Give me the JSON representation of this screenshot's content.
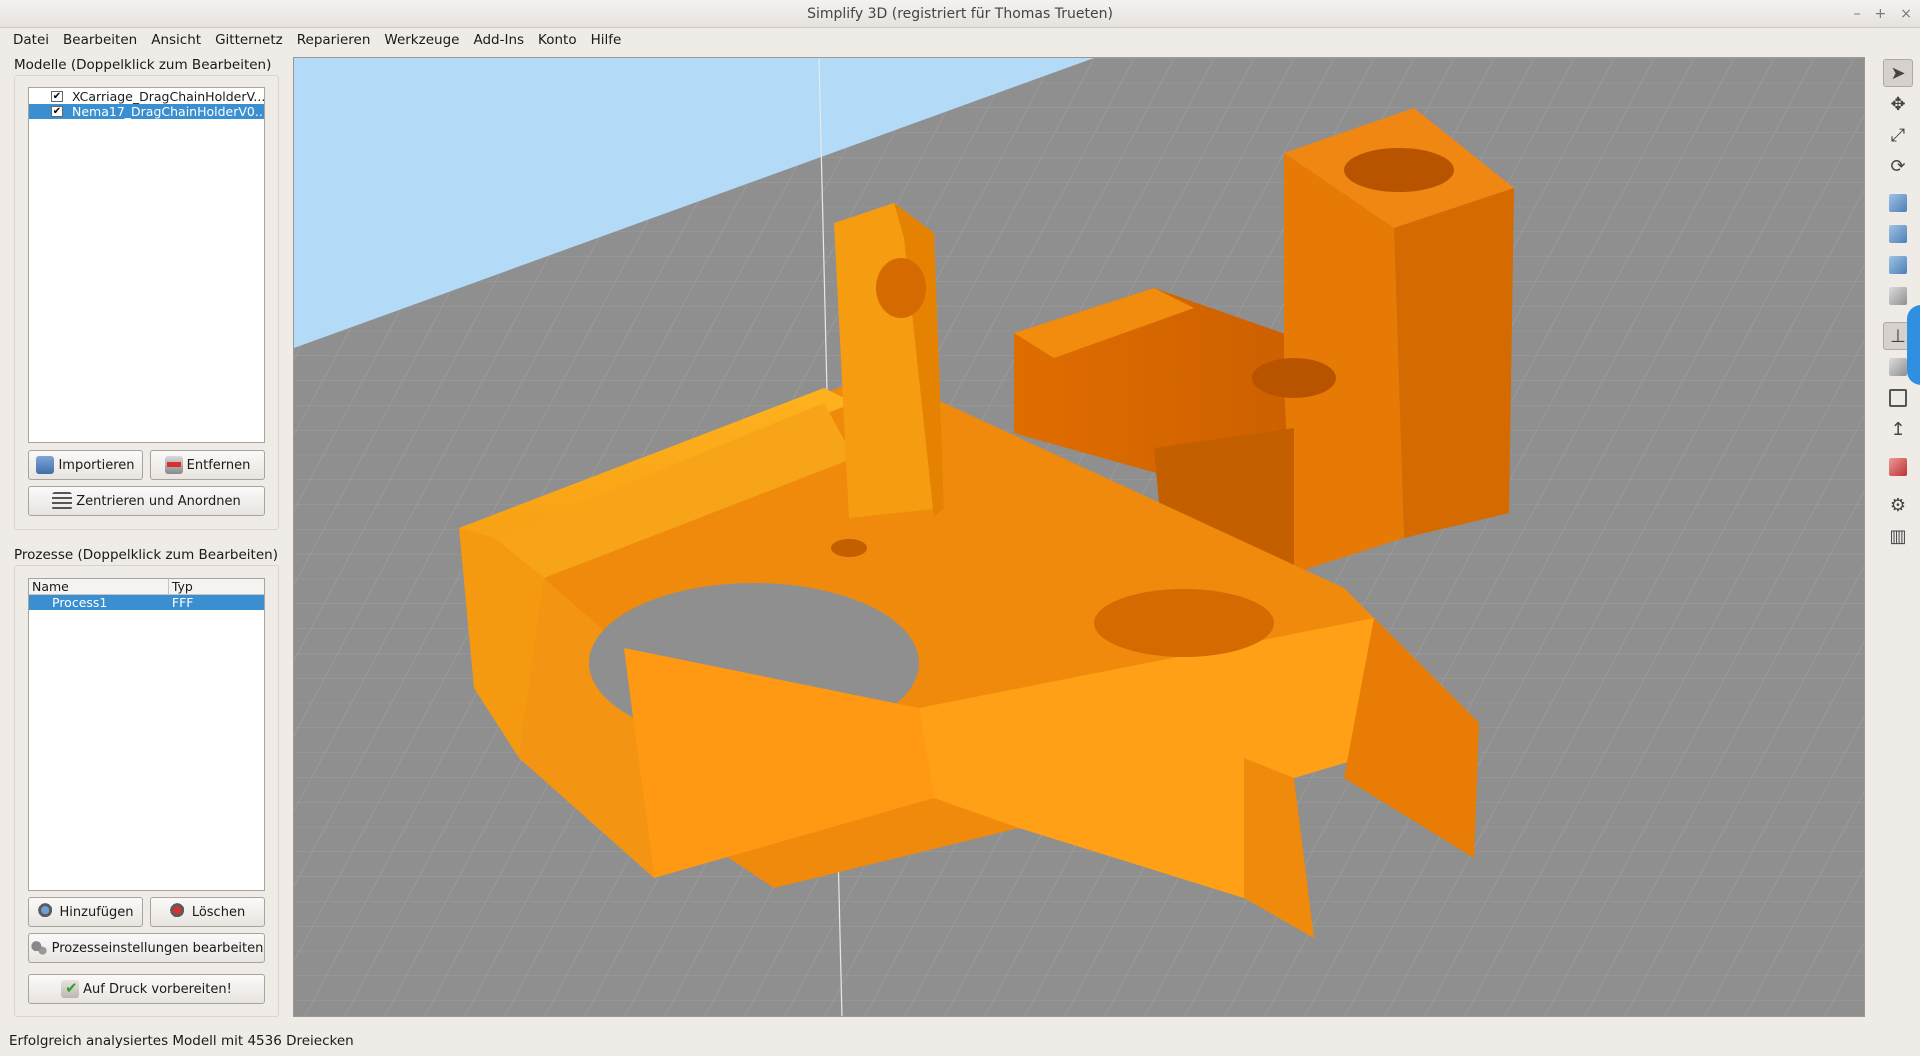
{
  "window": {
    "title": "Simplify 3D (registriert für Thomas Trueten)",
    "controls": [
      "–",
      "+",
      "×"
    ]
  },
  "menu": [
    "Datei",
    "Bearbeiten",
    "Ansicht",
    "Gitternetz",
    "Reparieren",
    "Werkzeuge",
    "Add-Ins",
    "Konto",
    "Hilfe"
  ],
  "models": {
    "title": "Modelle (Doppelklick zum Bearbeiten)",
    "items": [
      {
        "name": "XCarriage_DragChainHolderV...",
        "checked": true,
        "selected": false
      },
      {
        "name": "Nema17_DragChainHolderV0...",
        "checked": true,
        "selected": true
      }
    ],
    "import_label": "Importieren",
    "remove_label": "Entfernen",
    "arrange_label": "Zentrieren und Anordnen"
  },
  "processes": {
    "title": "Prozesse (Doppelklick zum Bearbeiten)",
    "columns": [
      "Name",
      "Typ"
    ],
    "rows": [
      {
        "name": "Process1",
        "type": "FFF"
      }
    ],
    "add_label": "Hinzufügen",
    "delete_label": "Löschen",
    "settings_label": "Prozesseinstellungen bearbeiten",
    "prepare_label": "Auf Druck vorbereiten!"
  },
  "toolbar_icons": [
    "cursor-icon",
    "move-icon",
    "scale-icon",
    "rotate-icon",
    "view-iso-icon",
    "view-front-icon",
    "view-top-icon",
    "view-side-icon",
    "axis-icon",
    "view-solid-icon",
    "view-wireframe-icon",
    "axis-z-icon",
    "cross-section-icon",
    "settings-gear-icon",
    "machine-icon"
  ],
  "colors": {
    "model": "#f28c0f",
    "bed": "#8f8f8f",
    "sky": "#b3dbf7",
    "selection": "#3a8fd0"
  },
  "status": "Erfolgreich analysiertes Modell mit 4536 Dreiecken"
}
